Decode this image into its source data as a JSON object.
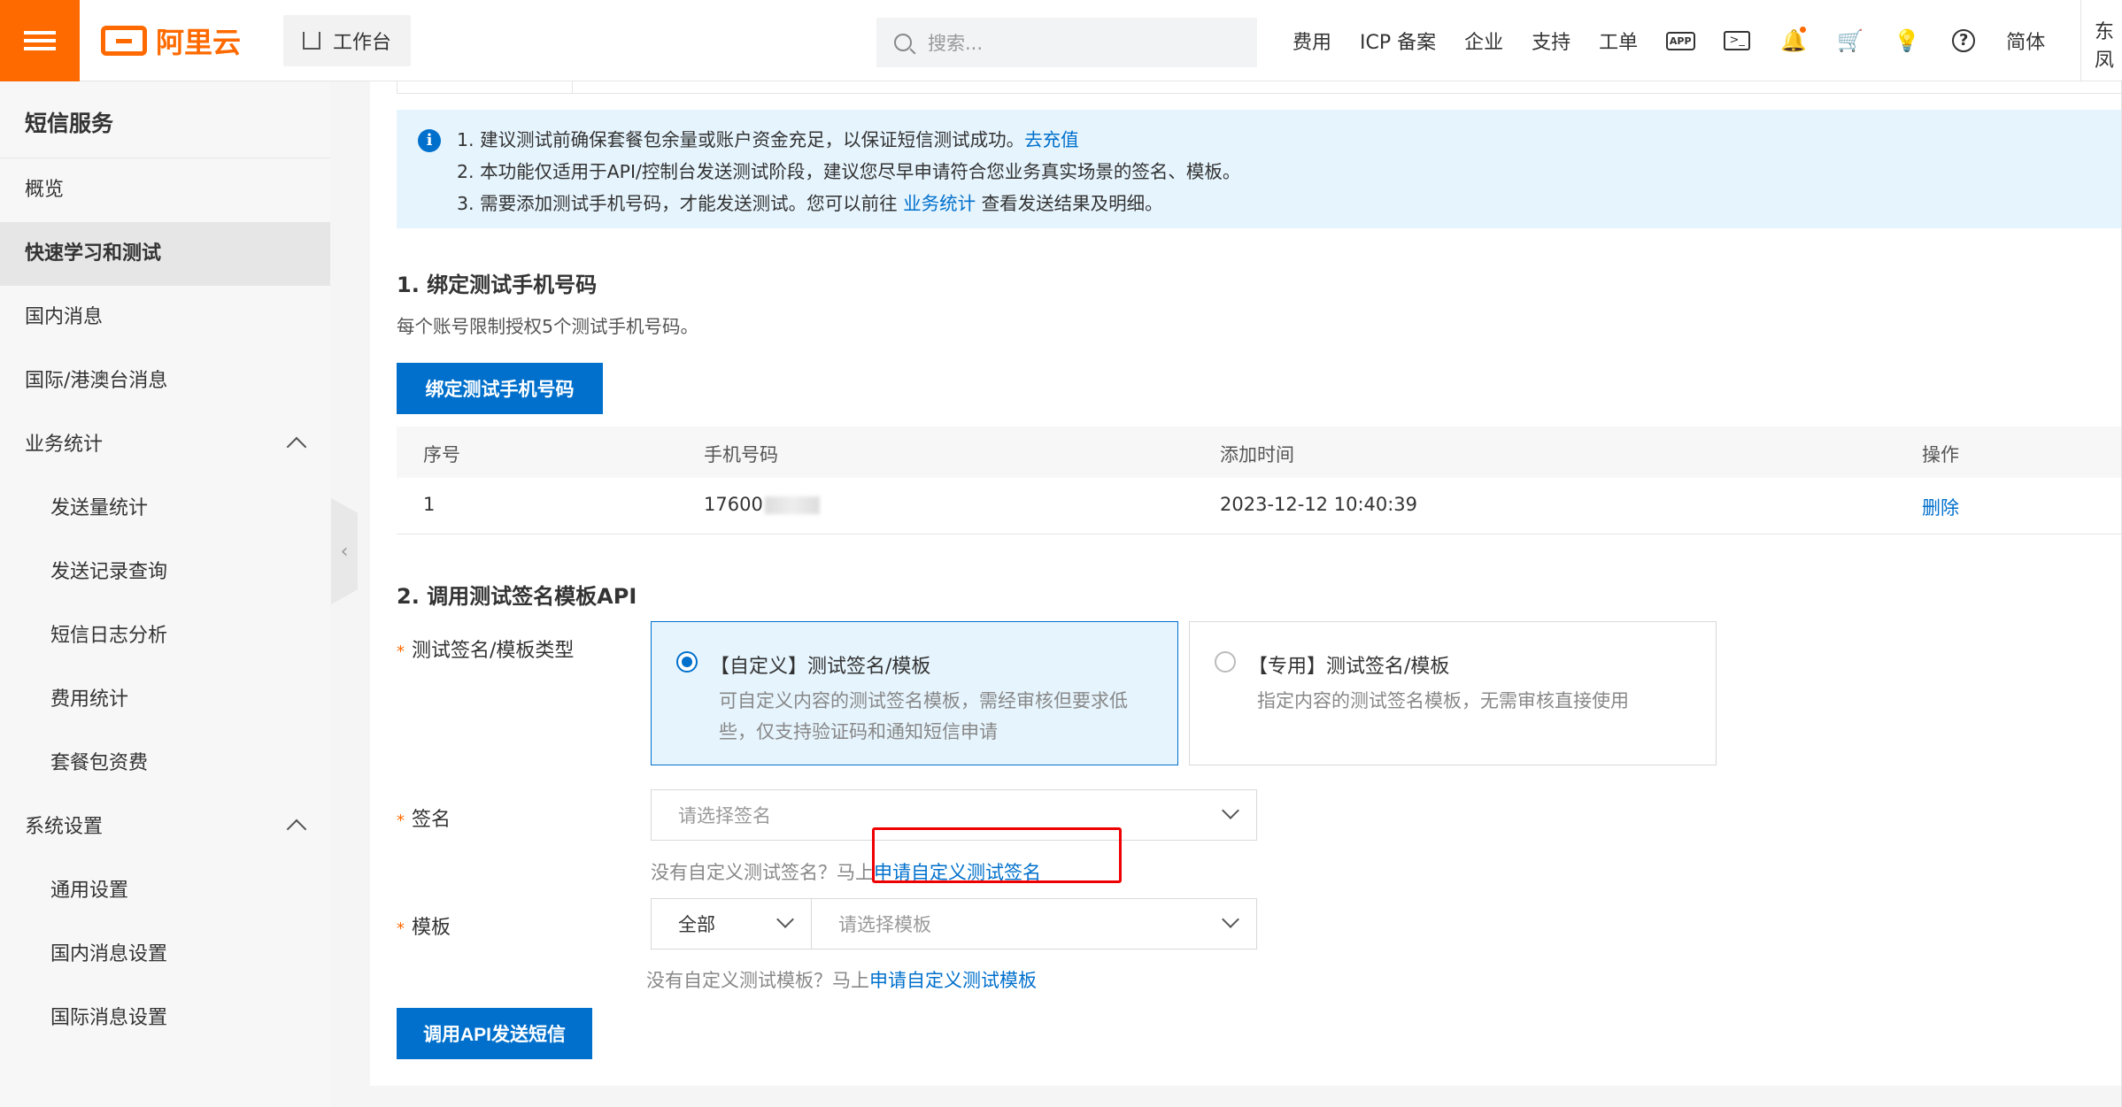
{
  "topbar": {
    "logo_text": "阿里云",
    "workbench_label": "工作台",
    "search_placeholder": "搜索...",
    "nav": [
      "费用",
      "ICP 备案",
      "企业",
      "支持",
      "工单"
    ],
    "app_icon_text": "APP",
    "lang_label": "简体",
    "truncated_text": "东凤"
  },
  "sidebar": {
    "title": "短信服务",
    "items": [
      {
        "label": "概览",
        "level": 1
      },
      {
        "label": "快速学习和测试",
        "level": 1,
        "active": true
      },
      {
        "label": "国内消息",
        "level": 1
      },
      {
        "label": "国际/港澳台消息",
        "level": 1
      },
      {
        "label": "业务统计",
        "level": 1,
        "expandable": true
      },
      {
        "label": "发送量统计",
        "level": 2
      },
      {
        "label": "发送记录查询",
        "level": 2
      },
      {
        "label": "短信日志分析",
        "level": 2
      },
      {
        "label": "费用统计",
        "level": 2
      },
      {
        "label": "套餐包资费",
        "level": 2
      },
      {
        "label": "系统设置",
        "level": 1,
        "expandable": true
      },
      {
        "label": "通用设置",
        "level": 2
      },
      {
        "label": "国内消息设置",
        "level": 2
      },
      {
        "label": "国际消息设置",
        "level": 2
      }
    ]
  },
  "notice": {
    "line1_text": "1. 建议测试前确保套餐包余量或账户资金充足，以保证短信测试成功。",
    "line1_link": "去充值",
    "line2_text": "2. 本功能仅适用于API/控制台发送测试阶段，建议您尽早申请符合您业务真实场景的签名、模板。",
    "line3_pre": "3. 需要添加测试手机号码，才能发送测试。您可以前往",
    "line3_link": "业务统计",
    "line3_post": "查看发送结果及明细。"
  },
  "section1": {
    "title": "1. 绑定测试手机号码",
    "desc": "每个账号限制授权5个测试手机号码。",
    "button": "绑定测试手机号码",
    "table": {
      "headers": [
        "序号",
        "手机号码",
        "添加时间",
        "操作"
      ],
      "rows": [
        {
          "index": "1",
          "phone": "17600",
          "time": "2023-12-12 10:40:39",
          "action": "删除"
        }
      ]
    }
  },
  "section2": {
    "title": "2. 调用测试签名模板API",
    "type_label": "测试签名/模板类型",
    "options": [
      {
        "title": "【自定义】测试签名/模板",
        "desc": "可自定义内容的测试签名模板，需经审核但要求低些，仅支持验证码和通知短信申请",
        "selected": true
      },
      {
        "title": "【专用】测试签名/模板",
        "desc": "指定内容的测试签名模板，无需审核直接使用",
        "selected": false
      }
    ],
    "sign_label": "签名",
    "sign_placeholder": "请选择签名",
    "sign_hint": "没有自定义测试签名？马上",
    "sign_hint_link": "申请自定义测试签名",
    "template_label": "模板",
    "template_filter": "全部",
    "template_placeholder": "请选择模板",
    "template_hint": "没有自定义测试模板？马上",
    "template_hint_link": "申请自定义测试模板",
    "submit": "调用API发送短信"
  },
  "colors": {
    "brand": "#ff6a00",
    "primary": "#0070cc",
    "highlight": "#e00000"
  }
}
